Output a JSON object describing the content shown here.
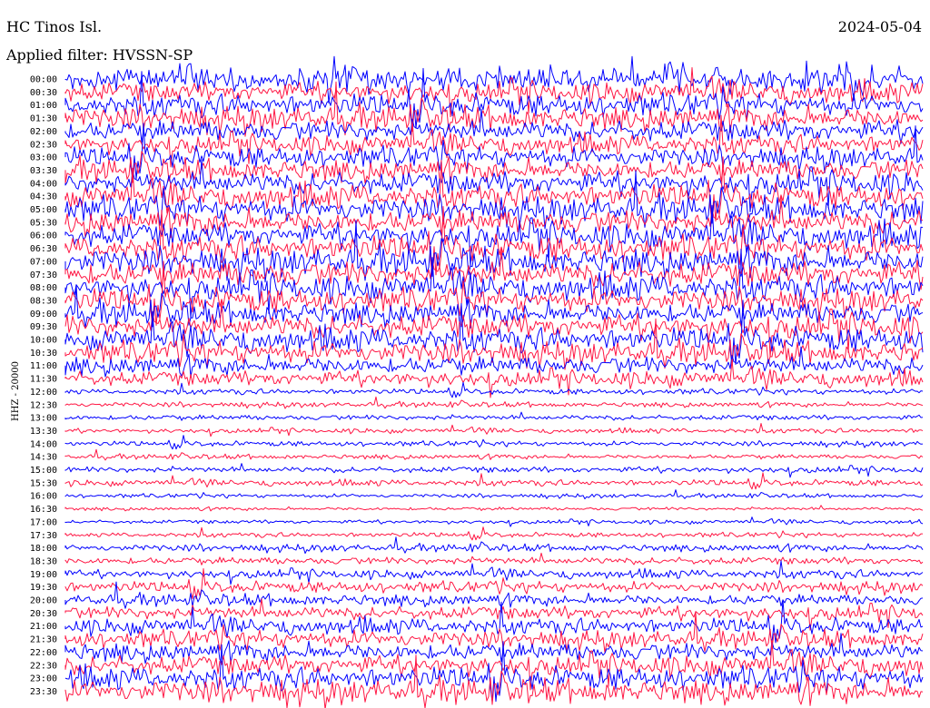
{
  "header": {
    "station": "HC Tinos Isl.",
    "date": "2024-05-04",
    "filter": "Applied filter: HVSSN-SP"
  },
  "channel_label": "HHZ - 20000",
  "colors": {
    "trace_a": "#0000ff",
    "trace_b": "#ff1744"
  },
  "chart_data": {
    "type": "helicorder",
    "title": "HC Tinos Isl.",
    "subtitle": "Applied filter: HVSSN-SP",
    "date": "2024-05-04",
    "ylabel": "HHZ - 20000",
    "row_labels": [
      "00:00",
      "00:30",
      "01:00",
      "01:30",
      "02:00",
      "02:30",
      "03:00",
      "03:30",
      "04:00",
      "04:30",
      "05:00",
      "05:30",
      "06:00",
      "06:30",
      "07:00",
      "07:30",
      "08:00",
      "08:30",
      "09:00",
      "09:30",
      "10:00",
      "10:30",
      "11:00",
      "11:30",
      "12:00",
      "12:30",
      "13:00",
      "13:30",
      "14:00",
      "14:30",
      "15:00",
      "15:30",
      "16:00",
      "16:30",
      "17:00",
      "17:30",
      "18:00",
      "18:30",
      "19:00",
      "19:30",
      "20:00",
      "20:30",
      "21:00",
      "21:30",
      "22:00",
      "22:30",
      "23:00",
      "23:30"
    ],
    "row_color_cycle": [
      "#0000ff",
      "#ff1744"
    ],
    "relative_amplitude": [
      1.6,
      1.3,
      1.4,
      1.5,
      1.4,
      1.2,
      1.3,
      1.4,
      1.5,
      1.5,
      1.6,
      1.6,
      1.6,
      1.6,
      1.7,
      1.7,
      1.6,
      1.5,
      1.5,
      1.6,
      1.5,
      1.4,
      1.2,
      1.0,
      0.35,
      0.32,
      0.35,
      0.3,
      0.32,
      0.3,
      0.4,
      0.38,
      0.25,
      0.22,
      0.25,
      0.3,
      0.45,
      0.5,
      0.55,
      0.7,
      0.75,
      0.9,
      1.0,
      1.1,
      1.2,
      1.3,
      1.4,
      1.5
    ],
    "grid": false
  }
}
